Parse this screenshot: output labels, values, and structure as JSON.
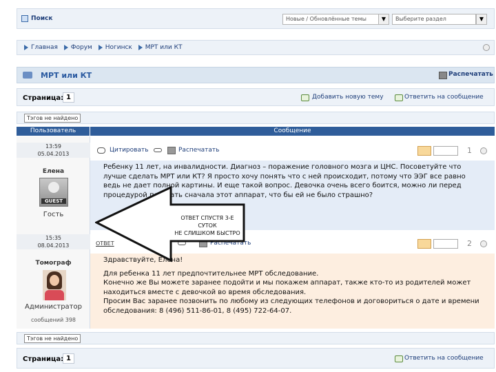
{
  "top": {
    "search_link": "Поиск",
    "select1": "Новые / Обновлённые темы",
    "select2": "Выберите раздел",
    "select_arrow": "▼"
  },
  "breadcrumbs": [
    "Главная",
    "Форум",
    "Ногинск",
    "МРТ или КТ"
  ],
  "topic": {
    "title": "МРТ или КТ",
    "print_label": "Распечатать"
  },
  "pager": {
    "page_label": "Страница:",
    "page_num": "1",
    "new_topic": "Добавить новую тему",
    "reply": "Ответить на сообщение"
  },
  "not_found_btn": "Тэгов не найдено",
  "table": {
    "col_user": "Пользователь",
    "col_message": "Сообщение"
  },
  "posts": [
    {
      "time": "13:59",
      "date": "05.04.2013",
      "author": "Елена",
      "avatar_text": "GUEST",
      "role": "Гость",
      "quote_label": "Цитировать",
      "print_label": "Распечатать",
      "number": "1",
      "text": "Ребенку 11 лет, на инвалидности. Диагноз – поражение головного мозга и ЦНС. Посоветуйте что лучше сделать МРТ или КТ? Я просто хочу понять что с ней происходит, потому что ЭЭГ все равно ведь не дает полной картины. И еще такой вопрос. Девочка очень всего боится, можно ли перед процедурой показать сначала этот аппарат, что бы ей не было страшно?"
    },
    {
      "time": "15:35",
      "date": "08.04.2013",
      "author": "Томограф",
      "role": "Администратор",
      "posts_count": "сообщений 398",
      "reply_label": "ОТВЕТ",
      "print_label": "Распечатать",
      "number": "2",
      "text_lines": [
        "Здравствуйте, Елена!",
        "",
        "Для ребенка 11 лет предпочтительнее МРТ обследование.",
        "Конечно же Вы можете заранее подойти и мы покажем аппарат, также кто-то из родителей может находиться вместе с девочкой во время обследования.",
        "Просим Вас заранее позвонить по любому из следующих телефонов и договоритьcя о дате и времени обследования: 8 (496) 511-86-01, 8 (495) 722-64-07."
      ]
    }
  ],
  "annotation": {
    "line1": "ОТВЕТ СПУСТЯ 3-Е СУТОК",
    "line2": "НЕ СЛИШКОМ БЫСТРО"
  },
  "bottom_pager": {
    "page_label": "Страница:",
    "page_num": "1",
    "reply": "Ответить на сообщение"
  },
  "colors": {
    "header_bg": "#dbe6f1",
    "col_head": "#2f5d9a",
    "post1_bg": "#e4ecf7",
    "post2_bg": "#fdeee0",
    "link": "#1d3d79"
  }
}
